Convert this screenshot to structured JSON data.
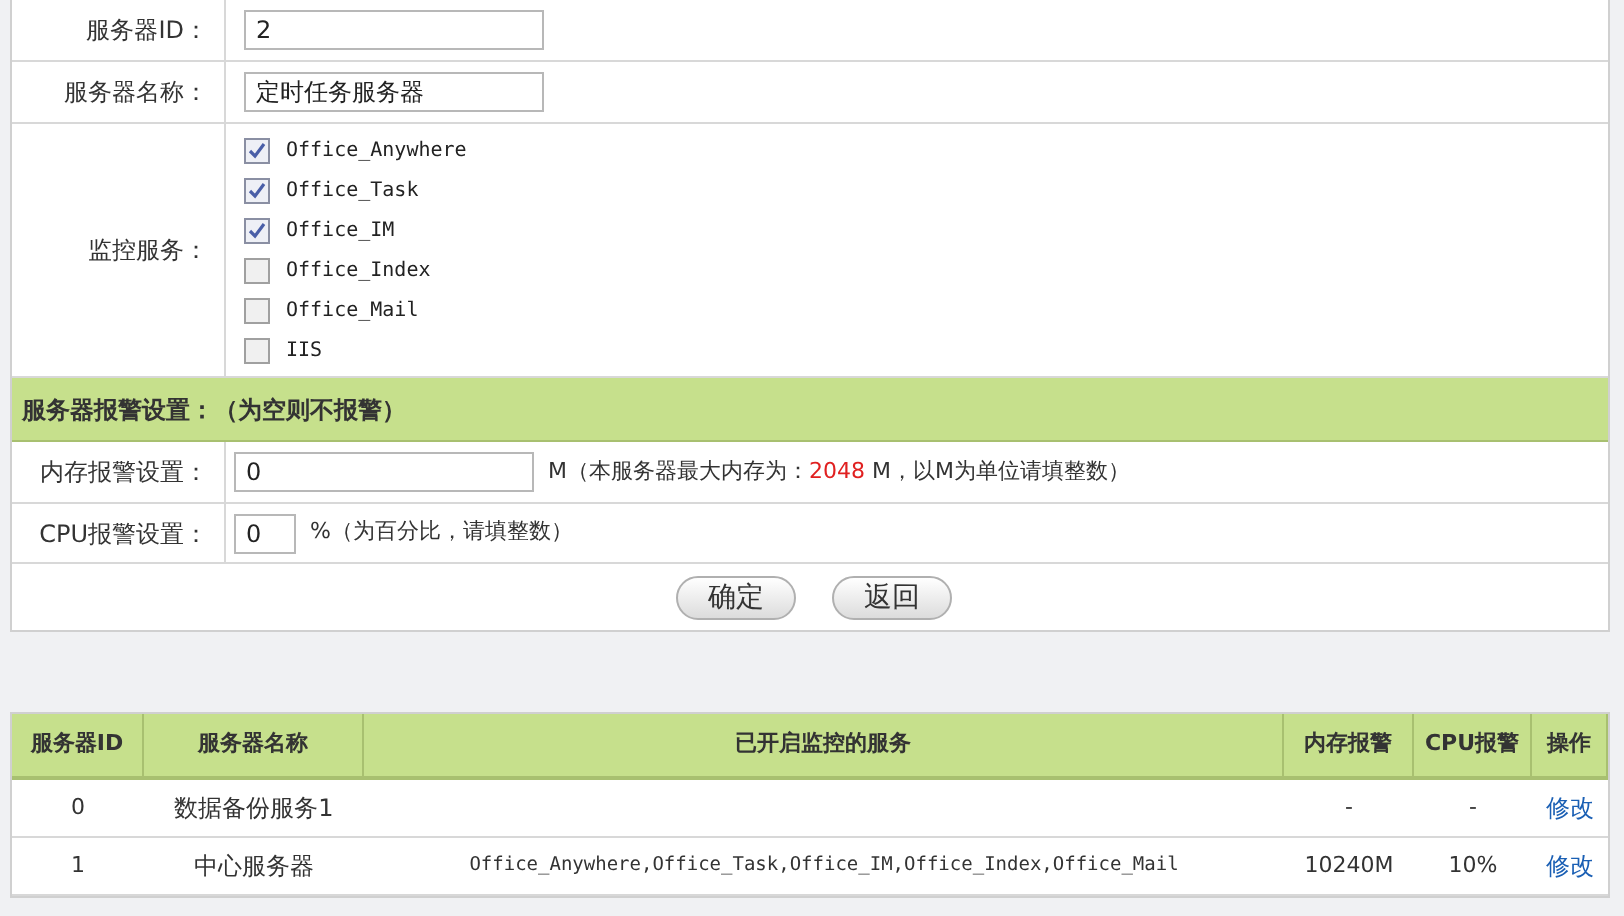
{
  "form": {
    "fields": [
      {
        "label": "服务器ID：",
        "value": "2"
      },
      {
        "label": "服务器名称：",
        "value": "定时任务服务器"
      }
    ],
    "services": {
      "label": "监控服务：",
      "items": [
        {
          "name": "Office_Anywhere",
          "checked": true
        },
        {
          "name": "Office_Task",
          "checked": true
        },
        {
          "name": "Office_IM",
          "checked": true
        },
        {
          "name": "Office_Index",
          "checked": false
        },
        {
          "name": "Office_Mail",
          "checked": false
        },
        {
          "name": "IIS",
          "checked": false
        }
      ]
    },
    "alarm_section": {
      "title": "服务器报警设置：（为空则不报警）"
    },
    "memory": {
      "label": "内存报警设置：",
      "value": "0",
      "hint_before": "M（本服务器最大内存为：",
      "max_memory": "2048",
      "hint_after": " M，以M为单位请填整数）"
    },
    "cpu": {
      "label": "CPU报警设置：",
      "value": "0",
      "hint": "%（为百分比，请填整数）"
    },
    "buttons": [
      "确定",
      "返回"
    ]
  },
  "table": {
    "columns": [
      "服务器ID",
      "服务器名称",
      "已开启监控的服务",
      "内存报警",
      "CPU报警",
      "操作"
    ],
    "rows": [
      {
        "id": "0",
        "name": "数据备份服务1",
        "services": "",
        "memory": "-",
        "cpu": "-",
        "action": "修改"
      },
      {
        "id": "1",
        "name": "中心服务器",
        "services": "Office_Anywhere,Office_Task,Office_IM,Office_Index,Office_Mail",
        "memory": "10240M",
        "cpu": "10%",
        "action": "修改"
      }
    ]
  }
}
